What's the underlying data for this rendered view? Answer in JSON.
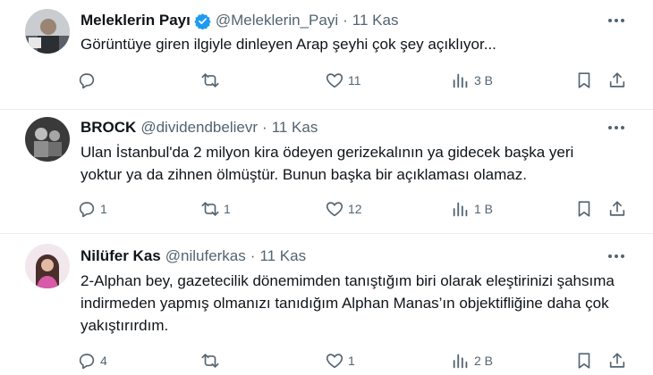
{
  "tweets": [
    {
      "name": "Meleklerin Payı",
      "verified": true,
      "handle": "@Meleklerin_Payi",
      "sep": "·",
      "time": "11 Kas",
      "text": "Görüntüye giren ilgiyle dinleyen Arap şeyhi çok şey açıklıyor...",
      "replies": "",
      "retweets": "",
      "likes": "11",
      "views": "3 B"
    },
    {
      "name": "BROCK",
      "verified": false,
      "handle": "@dividendbelievr",
      "sep": "·",
      "time": "11 Kas",
      "text": "Ulan İstanbul'da 2 milyon kira ödeyen gerizekalının ya gidecek başka yeri yoktur ya da zihnen ölmüştür. Bunun başka bir açıklaması olamaz.",
      "replies": "1",
      "retweets": "1",
      "likes": "12",
      "views": "1 B"
    },
    {
      "name": "Nilüfer Kas",
      "verified": false,
      "handle": "@niluferkas",
      "sep": "·",
      "time": "11 Kas",
      "text": "2-Alphan bey, gazetecilik dönemimden tanıştığım biri olarak eleştirinizi şahsıma indirmeden yapmış olmanızı tanıdığım Alphan Manas’ın objektifliğine daha çok yakıştırırdım.",
      "replies": "4",
      "retweets": "",
      "likes": "1",
      "views": "2 B"
    }
  ],
  "colors": {
    "text": "#0f1419",
    "muted": "#536471",
    "verified": "#1d9bf0",
    "divider": "#e6ecf0"
  },
  "icons": [
    "verified-badge-icon",
    "more-icon",
    "reply-icon",
    "retweet-icon",
    "like-icon",
    "views-icon",
    "bookmark-icon",
    "share-icon"
  ]
}
